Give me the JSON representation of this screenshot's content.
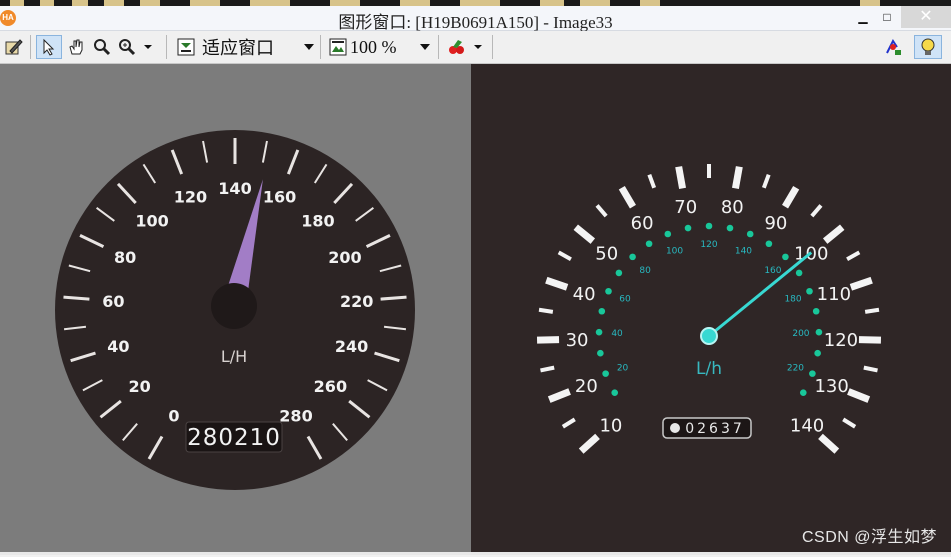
{
  "window": {
    "title": "图形窗口: [H19B0691A150] - Image33",
    "app_icon_label": "HA",
    "minimize_symbol": "▁",
    "maximize_symbol": "□",
    "close_symbol": "✕"
  },
  "toolbar": {
    "fit_label": "适应窗口",
    "zoom_label": "100 %",
    "icons": [
      "edit-icon",
      "pointer-icon",
      "hand-icon",
      "magnifier-icon",
      "zoom-icon",
      "fit-window-icon",
      "zoom-picture-icon",
      "color-picker-icon",
      "region-icon",
      "bulb-icon"
    ]
  },
  "gauge_left": {
    "scale_labels": [
      "0",
      "20",
      "40",
      "60",
      "80",
      "100",
      "120",
      "140",
      "160",
      "180",
      "200",
      "220",
      "240",
      "260",
      "280"
    ],
    "unit": "L/H",
    "odometer": "280210",
    "needle_value": 152,
    "colors": {
      "face": "#2c2424",
      "needle": "#a27dc6",
      "background": "#7c7c7c"
    }
  },
  "gauge_right": {
    "outer_labels": [
      "10",
      "20",
      "30",
      "40",
      "50",
      "60",
      "70",
      "80",
      "90",
      "100",
      "110",
      "120",
      "130",
      "140"
    ],
    "inner_labels": [
      "20",
      "40",
      "60",
      "80",
      "100",
      "120",
      "140",
      "160",
      "180",
      "200",
      "220"
    ],
    "unit": "L/h",
    "odometer": "02637",
    "needle_value": 100,
    "colors": {
      "face": "#2f2626",
      "needle": "#38d8d2",
      "accent": "#19c79a"
    }
  },
  "watermark": "CSDN @浮生如梦"
}
